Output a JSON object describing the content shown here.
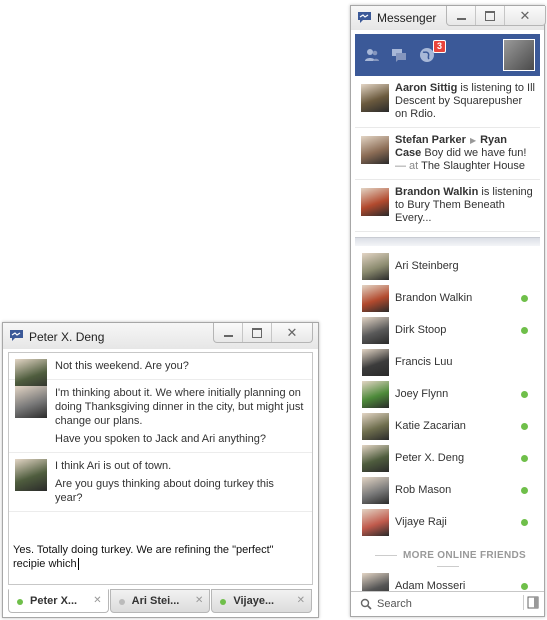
{
  "messenger": {
    "title": "Messenger",
    "notifications_count": "3",
    "ticker": [
      {
        "name": "Aaron Sittig",
        "text": " is listening to Ill Descent by Squarepusher on Rdio.",
        "color": "#6b5a3e"
      },
      {
        "name": "Stefan Parker",
        "arrow": "▶",
        "name2": "Ryan Case",
        "text": " Boy did we have fun!",
        "meta": " — at ",
        "place": "The Slaughter House",
        "color": "#8c6d56"
      },
      {
        "name": "Brandon Walkin",
        "text": " is listening to Bury Them Beneath Every...",
        "color": "#b24a2e"
      }
    ],
    "friends": [
      {
        "name": "Ari Steinberg",
        "online": false,
        "color": "#8b8b6f"
      },
      {
        "name": "Brandon Walkin",
        "online": true,
        "color": "#b24a2e"
      },
      {
        "name": "Dirk Stoop",
        "online": true,
        "color": "#5a5a5a"
      },
      {
        "name": "Francis Luu",
        "online": false,
        "color": "#3c3c3c"
      },
      {
        "name": "Joey Flynn",
        "online": true,
        "color": "#4d8a3a"
      },
      {
        "name": "Katie Zacarian",
        "online": true,
        "color": "#6e6e4e"
      },
      {
        "name": "Peter X. Deng",
        "online": true,
        "color": "#4f5d3e"
      },
      {
        "name": "Rob Mason",
        "online": true,
        "color": "#7a7a7a"
      },
      {
        "name": "Vijaye Raji",
        "online": true,
        "color": "#c05a4c"
      }
    ],
    "more_label": "MORE ONLINE FRIENDS",
    "more_friend": {
      "name": "Adam Mosseri",
      "online": true,
      "color": "#555555"
    },
    "search_placeholder": "Search"
  },
  "chat": {
    "title": "Peter X. Deng",
    "messages": [
      {
        "lines": [
          "Not this weekend. Are you?"
        ],
        "color": "#4f5d3e"
      },
      {
        "lines": [
          "I'm thinking about it. We where initially planning on doing Thanksgiving dinner in the city, but might just change our plans.",
          "Have you spoken to Jack and Ari anything?"
        ],
        "color": "#7a7a7a"
      },
      {
        "lines": [
          "I think Ari is out of town.",
          "Are you guys thinking about doing turkey this year?"
        ],
        "color": "#4f5d3e"
      }
    ],
    "composer_text": "Yes. Totally doing turkey. We are refining the \"perfect\" recipie which",
    "tabs": [
      {
        "label": "Peter X...",
        "online": true,
        "active": true
      },
      {
        "label": "Ari Stei...",
        "online": false,
        "active": false
      },
      {
        "label": "Vijaye...",
        "online": true,
        "active": false
      }
    ]
  }
}
